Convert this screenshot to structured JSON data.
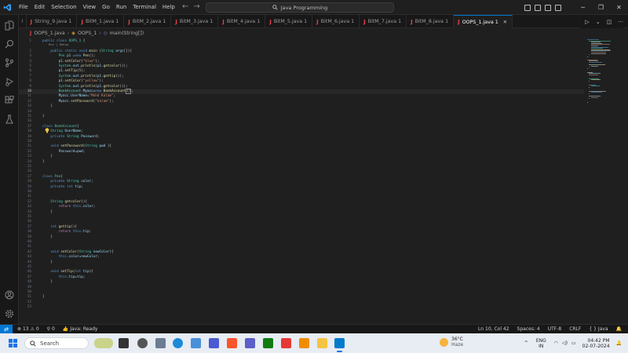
{
  "menu": [
    "File",
    "Edit",
    "Selection",
    "View",
    "Go",
    "Run",
    "Terminal",
    "Help"
  ],
  "command_center": "Java Programming",
  "tabs": [
    {
      "label": "String_9.java",
      "extra": "1",
      "active": false
    },
    {
      "label": "BitM_1.java",
      "extra": "1",
      "active": false
    },
    {
      "label": "BitM_2.java",
      "extra": "1",
      "active": false
    },
    {
      "label": "BitM_3.java",
      "extra": "1",
      "active": false
    },
    {
      "label": "BitM_4.java",
      "extra": "1",
      "active": false
    },
    {
      "label": "BitM_5.java",
      "extra": "1",
      "active": false
    },
    {
      "label": "BitM_6.java",
      "extra": "1",
      "active": false
    },
    {
      "label": "BitM_7.java",
      "extra": "1",
      "active": false
    },
    {
      "label": "BitM_8.java",
      "extra": "1",
      "active": false
    },
    {
      "label": "OOPS_1.java",
      "extra": "1",
      "active": true
    }
  ],
  "tab_first_partial": "!",
  "breadcrumb": {
    "file": "OOPS_1.java",
    "class": "OOPS_1",
    "method": "main(String[])"
  },
  "codelens": "Run | Debug",
  "code_lines": [
    {
      "n": "1",
      "html": "<span class='kw'>public class</span> <span class='ty'>OOPS_1</span> {"
    },
    {
      "n": "2",
      "html": "    <span class='kw'>public static void</span> <span class='fn'>main</span> (<span class='ty'>String</span> <span class='vr'>args</span>[]){"
    },
    {
      "n": "3",
      "html": "        <span class='ty'>Pen</span> <span class='vr'>p1</span> =<span class='kw'>new</span> <span class='fn'>Pen</span>();"
    },
    {
      "n": "4",
      "html": "        <span class='vr'>p1</span>.<span class='fn'>setColor</span>(<span class='st'>\"blue\"</span>);"
    },
    {
      "n": "5",
      "html": "        <span class='ty'>System</span>.<span class='vr'>out</span>.<span class='fn'>println</span>(<span class='vr'>p1</span>.<span class='fn'>getcolor</span>());"
    },
    {
      "n": "6",
      "html": "        <span class='vr'>p1</span>.<span class='fn'>setTip</span>(<span class='nu'>5</span>);"
    },
    {
      "n": "7",
      "html": "        <span class='ty'>System</span>.<span class='vr'>out</span>.<span class='fn'>println</span>(<span class='vr'>p1</span>.<span class='fn'>gettip</span>());"
    },
    {
      "n": "8",
      "html": "        <span class='vr'>p1</span>.<span class='fn'>setColor</span>(<span class='st'>\"yellow\"</span>);"
    },
    {
      "n": "9",
      "html": "        <span class='ty'>System</span>.<span class='vr'>out</span>.<span class='fn'>println</span>(<span class='vr'>p1</span>.<span class='fn'>getcolor</span>());"
    },
    {
      "n": "10",
      "html": "        <span class='ty'>BankAccount</span> <span class='vr'>Myacc</span>=<span class='kw'>new</span> <span class='fn'>BankAccount</span><span class='cursor-box'>()</span>;",
      "current": true
    },
    {
      "n": "11",
      "html": "        <span class='vr'>Myacc</span>.<span class='vr'>UserName</span>=<span class='st'>\"Mohd Kalam\"</span>;"
    },
    {
      "n": "12",
      "html": "        <span class='vr'>Myacc</span>.<span class='fn'>setPassword</span>(<span class='st'>\"kalam\"</span>);"
    },
    {
      "n": "13",
      "html": "    }"
    },
    {
      "n": "14",
      "html": ""
    },
    {
      "n": "15",
      "html": "}"
    },
    {
      "n": "16",
      "html": ""
    },
    {
      "n": "17",
      "html": "<span class='kw'>class</span> <span class='ty'>BankAccount</span>{"
    },
    {
      "n": "18",
      "html": "    <span class='ty'>String</span> <span class='vr'>UserName</span>;"
    },
    {
      "n": "19",
      "html": "    <span class='kw'>private</span> <span class='ty'>String</span> <span class='vr'>Password</span>;"
    },
    {
      "n": "20",
      "html": ""
    },
    {
      "n": "21",
      "html": "    <span class='kw'>void</span> <span class='fn'>setPassword</span>(<span class='ty'>String</span> <span class='vr'>pwd</span> ){"
    },
    {
      "n": "22",
      "html": "        <span class='vr'>Password</span>=<span class='vr'>pwd</span>;"
    },
    {
      "n": "23",
      "html": "    }"
    },
    {
      "n": "24",
      "html": "}"
    },
    {
      "n": "25",
      "html": ""
    },
    {
      "n": "26",
      "html": ""
    },
    {
      "n": "27",
      "html": "<span class='kw'>class</span> <span class='ty'>Pen</span>{"
    },
    {
      "n": "28",
      "html": "    <span class='kw'>private</span> <span class='ty'>String</span> <span class='vr'>color</span>;"
    },
    {
      "n": "29",
      "html": "    <span class='kw'>private int</span> <span class='vr'>tip</span>;"
    },
    {
      "n": "30",
      "html": ""
    },
    {
      "n": "31",
      "html": ""
    },
    {
      "n": "32",
      "html": "    <span class='ty'>String</span> <span class='fn'>getcolor</span>(){"
    },
    {
      "n": "33",
      "html": "        <span class='kw2'>return</span> <span class='kw'>this</span>.<span class='vr'>color</span>;"
    },
    {
      "n": "34",
      "html": "    }"
    },
    {
      "n": "35",
      "html": ""
    },
    {
      "n": "36",
      "html": ""
    },
    {
      "n": "37",
      "html": "    <span class='kw'>int</span> <span class='fn'>gettip</span>(){"
    },
    {
      "n": "38",
      "html": "        <span class='kw2'>return</span> <span class='kw'>this</span>.<span class='vr'>tip</span>;"
    },
    {
      "n": "39",
      "html": "    }"
    },
    {
      "n": "40",
      "html": ""
    },
    {
      "n": "41",
      "html": ""
    },
    {
      "n": "42",
      "html": "    <span class='kw'>void</span> <span class='fn'>setColor</span>(<span class='ty'>String</span> <span class='vr'>newColor</span>){"
    },
    {
      "n": "43",
      "html": "        <span class='kw'>this</span>.<span class='vr'>color</span>=<span class='vr'>newColor</span>;"
    },
    {
      "n": "44",
      "html": "    }"
    },
    {
      "n": "45",
      "html": ""
    },
    {
      "n": "46",
      "html": "    <span class='kw'>void</span> <span class='fn'>setTip</span>(<span class='kw'>int</span> <span class='vr'>tip</span>){"
    },
    {
      "n": "47",
      "html": "        <span class='kw'>this</span>.<span class='vr'>tip</span>=<span class='vr'>tip</span>;"
    },
    {
      "n": "48",
      "html": "    }"
    },
    {
      "n": "49",
      "html": ""
    },
    {
      "n": "50",
      "html": ""
    },
    {
      "n": "51",
      "html": "}"
    },
    {
      "n": "52",
      "html": ""
    },
    {
      "n": "53",
      "html": ""
    }
  ],
  "status": {
    "errors": "13",
    "warnings": "0",
    "ports": "0",
    "java_status": "Java: Ready",
    "position": "Ln 10, Col 42",
    "spaces": "Spaces: 4",
    "encoding": "UTF-8",
    "eol": "CRLF",
    "language": "Java"
  },
  "taskbar": {
    "search_placeholder": "Search",
    "weather_temp": "36°C",
    "weather_desc": "Haze",
    "lang_top": "ENG",
    "lang_bottom": "IN",
    "time": "04:42 PM",
    "date": "02-07-2024"
  }
}
